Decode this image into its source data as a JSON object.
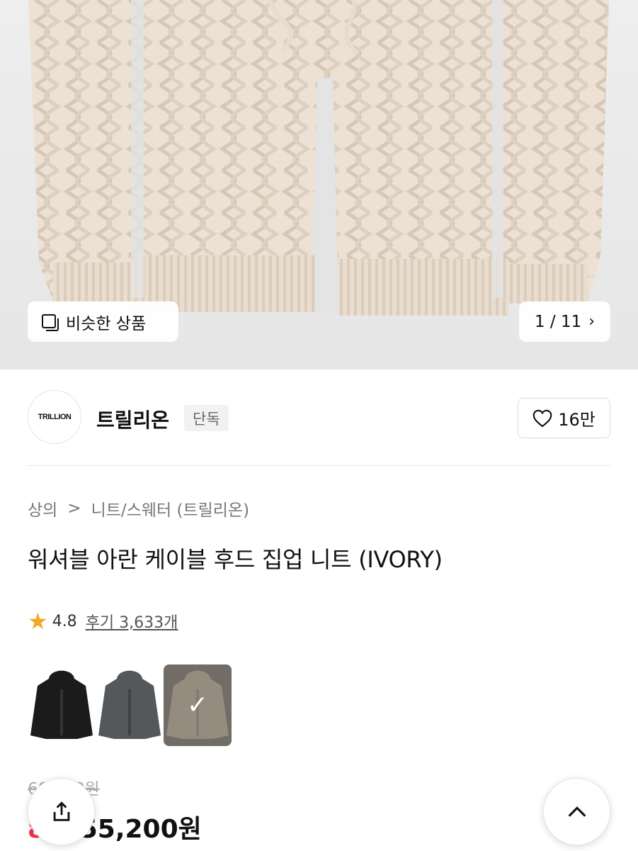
{
  "gallery": {
    "similar_label": "비슷한 상품",
    "counter": "1 / 11",
    "icon": "chevron-right-icon"
  },
  "brand": {
    "logo_text": "TRILLION",
    "name": "트릴리온",
    "badge": "단독",
    "likes": "16만"
  },
  "breadcrumb": {
    "level1": "상의",
    "separator": ">",
    "level2": "니트/스웨터 (트릴리온)"
  },
  "product": {
    "title": "워셔블 아란 케이블 후드 집업 니트 (IVORY)"
  },
  "rating": {
    "score": "4.8",
    "reviews": "후기 3,633개"
  },
  "swatches": [
    {
      "color": "black",
      "hex": "#1b1b1b"
    },
    {
      "color": "charcoal",
      "hex": "#55585b"
    },
    {
      "color": "ivory",
      "hex": "#b6aa9b",
      "selected": true
    }
  ],
  "price": {
    "original": "60,000원",
    "discount": "8%",
    "current": "55,200원"
  },
  "colors": {
    "accent_red": "#f0334b",
    "star": "#f5a623"
  }
}
